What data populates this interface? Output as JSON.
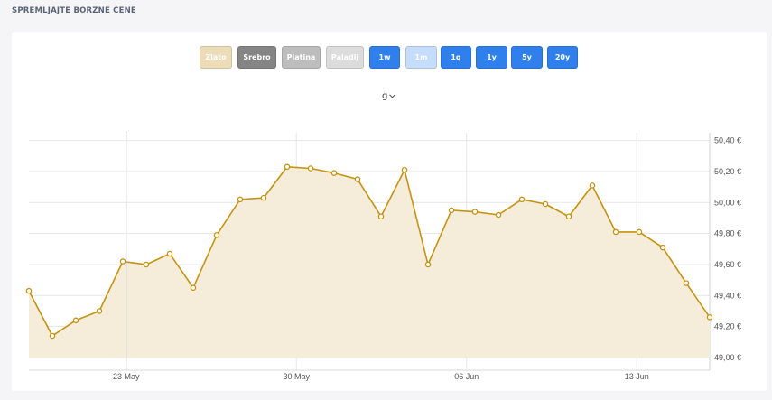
{
  "page": {
    "title": "SPREMLJAJTE BORZNE CENE"
  },
  "metals": [
    {
      "label": "Zlato",
      "color": "#ecdcb7"
    },
    {
      "label": "Srebro",
      "color": "#858585"
    },
    {
      "label": "Platina",
      "color": "#bdbdbd"
    },
    {
      "label": "Paladij",
      "color": "#dcdcdc"
    }
  ],
  "periods": [
    {
      "label": "1w",
      "color": "#2f80ed"
    },
    {
      "label": "1m",
      "color": "#c6dcfb"
    },
    {
      "label": "1q",
      "color": "#2f80ed"
    },
    {
      "label": "1y",
      "color": "#2f80ed"
    },
    {
      "label": "5y",
      "color": "#2f80ed"
    },
    {
      "label": "20y",
      "color": "#2f80ed"
    }
  ],
  "unit": {
    "selected": "g"
  },
  "colors": {
    "line": "#c4930f",
    "fill": "#f5ecd9",
    "grid": "#e6e6e6",
    "axis_text": "#555555"
  },
  "chart_data": {
    "type": "area",
    "x": [
      "2022-05-19",
      "2022-05-20",
      "2022-05-21",
      "2022-05-22",
      "2022-05-23",
      "2022-05-24",
      "2022-05-25",
      "2022-05-26",
      "2022-05-27",
      "2022-05-28",
      "2022-05-29",
      "2022-05-30",
      "2022-05-31",
      "2022-06-01",
      "2022-06-02",
      "2022-06-03",
      "2022-06-04",
      "2022-06-05",
      "2022-06-06",
      "2022-06-07",
      "2022-06-08",
      "2022-06-09",
      "2022-06-10",
      "2022-06-11",
      "2022-06-12",
      "2022-06-13",
      "2022-06-14",
      "2022-06-15",
      "2022-06-16"
    ],
    "values": [
      49.43,
      49.14,
      49.24,
      49.3,
      49.62,
      49.6,
      49.67,
      49.45,
      49.79,
      50.02,
      50.03,
      50.23,
      50.22,
      50.19,
      50.15,
      49.91,
      50.21,
      49.6,
      49.95,
      49.94,
      49.92,
      50.02,
      49.99,
      49.91,
      50.11,
      49.81,
      49.81,
      49.71,
      49.48,
      49.26
    ],
    "ylim": [
      49.0,
      50.45
    ],
    "yticks": [
      "49,00 €",
      "49,20 €",
      "49,40 €",
      "49,60 €",
      "49,80 €",
      "50,00 €",
      "50,20 €",
      "50,40 €"
    ],
    "ytick_values": [
      49.0,
      49.2,
      49.4,
      49.6,
      49.8,
      50.0,
      50.2,
      50.4
    ],
    "xticks": [
      "23 May",
      "30 May",
      "06 Jun",
      "13 Jun"
    ],
    "xtick_dates": [
      "2022-05-23",
      "2022-05-30",
      "2022-06-06",
      "2022-06-13"
    ],
    "crosshair_date": "2022-05-23",
    "grid": true
  }
}
